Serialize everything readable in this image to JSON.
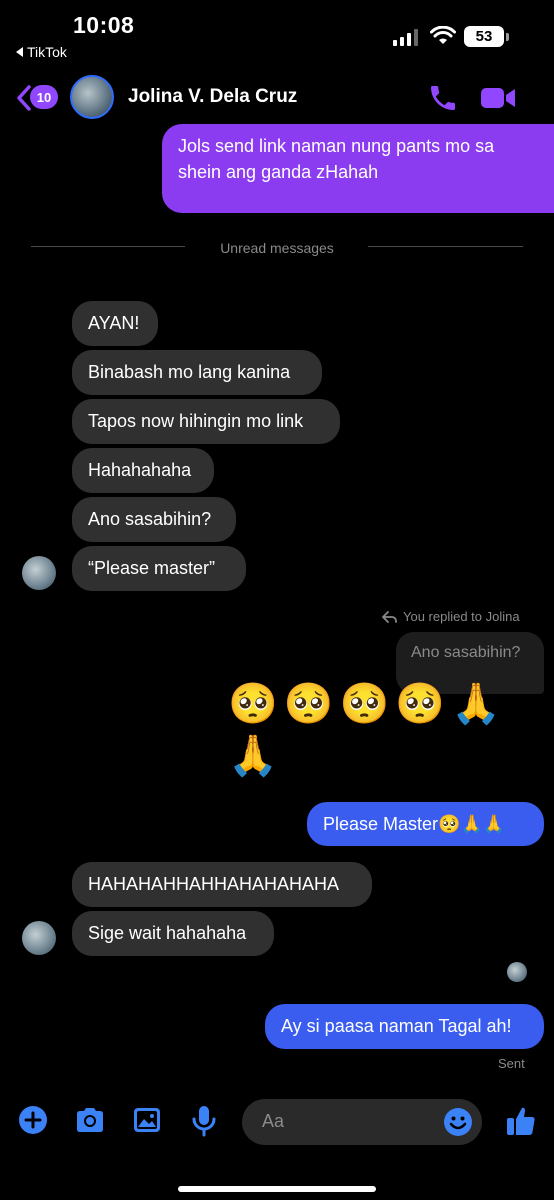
{
  "status_bar": {
    "time": "10:08",
    "back_app": "TikTok",
    "battery": "53"
  },
  "header": {
    "unread_count": "10",
    "contact_name": "Jolina V. Dela Cruz"
  },
  "messages": {
    "first_sent": [
      "Jols send link naman nung pants mo sa",
      "shein ang ganda zHahah"
    ],
    "unread_divider": "Unread messages",
    "received_group_1": [
      "AYAN!",
      "Binabash mo lang kanina",
      "Tapos now hihingin mo link",
      "Hahahahaha",
      "Ano sasabihin?",
      "“Please master”"
    ],
    "replied_note": "You replied to Jolina",
    "quoted_text": "Ano sasabihin?",
    "emoji_line_1": "🥺🥺🥺🥺🙏🙏",
    "emoji_line_2": "🙏",
    "sent_please": "Please Master🥺🙏🙏",
    "received_group_2": [
      "HAHAHAHHAHHAHAHAHAHA",
      "Sige wait hahahaha"
    ],
    "last_sent": "Ay si paasa naman Tagal ah!",
    "sent_status": "Sent"
  },
  "composer": {
    "placeholder": "Aa"
  },
  "colors": {
    "accent_purple": "#9146ff",
    "sent_purple": "#8c3cf0",
    "sent_blue": "#3a5df0",
    "icon_blue": "#3b82f6",
    "received_bg": "#303030"
  }
}
